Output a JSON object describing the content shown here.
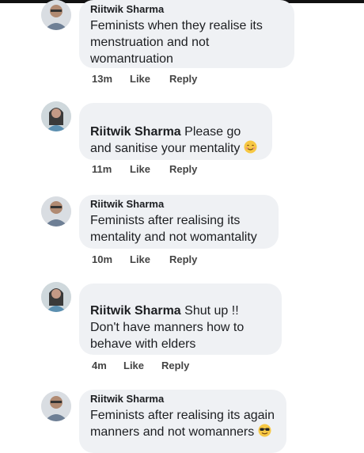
{
  "comments": [
    {
      "author": "Riitwik Sharma",
      "text": "Feminists when they realise its menstruation and not womantruation",
      "time": "13m",
      "like": "Like",
      "reply": "Reply"
    },
    {
      "author": "Riitwik Sharma",
      "text": "Please go and sanitise your mentality",
      "time": "11m",
      "like": "Like",
      "reply": "Reply",
      "emoji": "smiling-face-emoji"
    },
    {
      "author": "Riitwik Sharma",
      "text": "Feminists after realising its mentality and not womantality",
      "time": "10m",
      "like": "Like",
      "reply": "Reply"
    },
    {
      "author": "Riitwik Sharma",
      "text": "Shut up !! Don't have manners how to behave with elders",
      "time": "4m",
      "like": "Like",
      "reply": "Reply"
    },
    {
      "author": "Riitwik Sharma",
      "text": "Feminists after realising its again manners and not womanners",
      "emoji": "sunglasses-face-emoji"
    }
  ],
  "colors": {
    "bubble": "#eff1f4",
    "redaction": "#f26a1b",
    "meta_text": "#444444"
  }
}
